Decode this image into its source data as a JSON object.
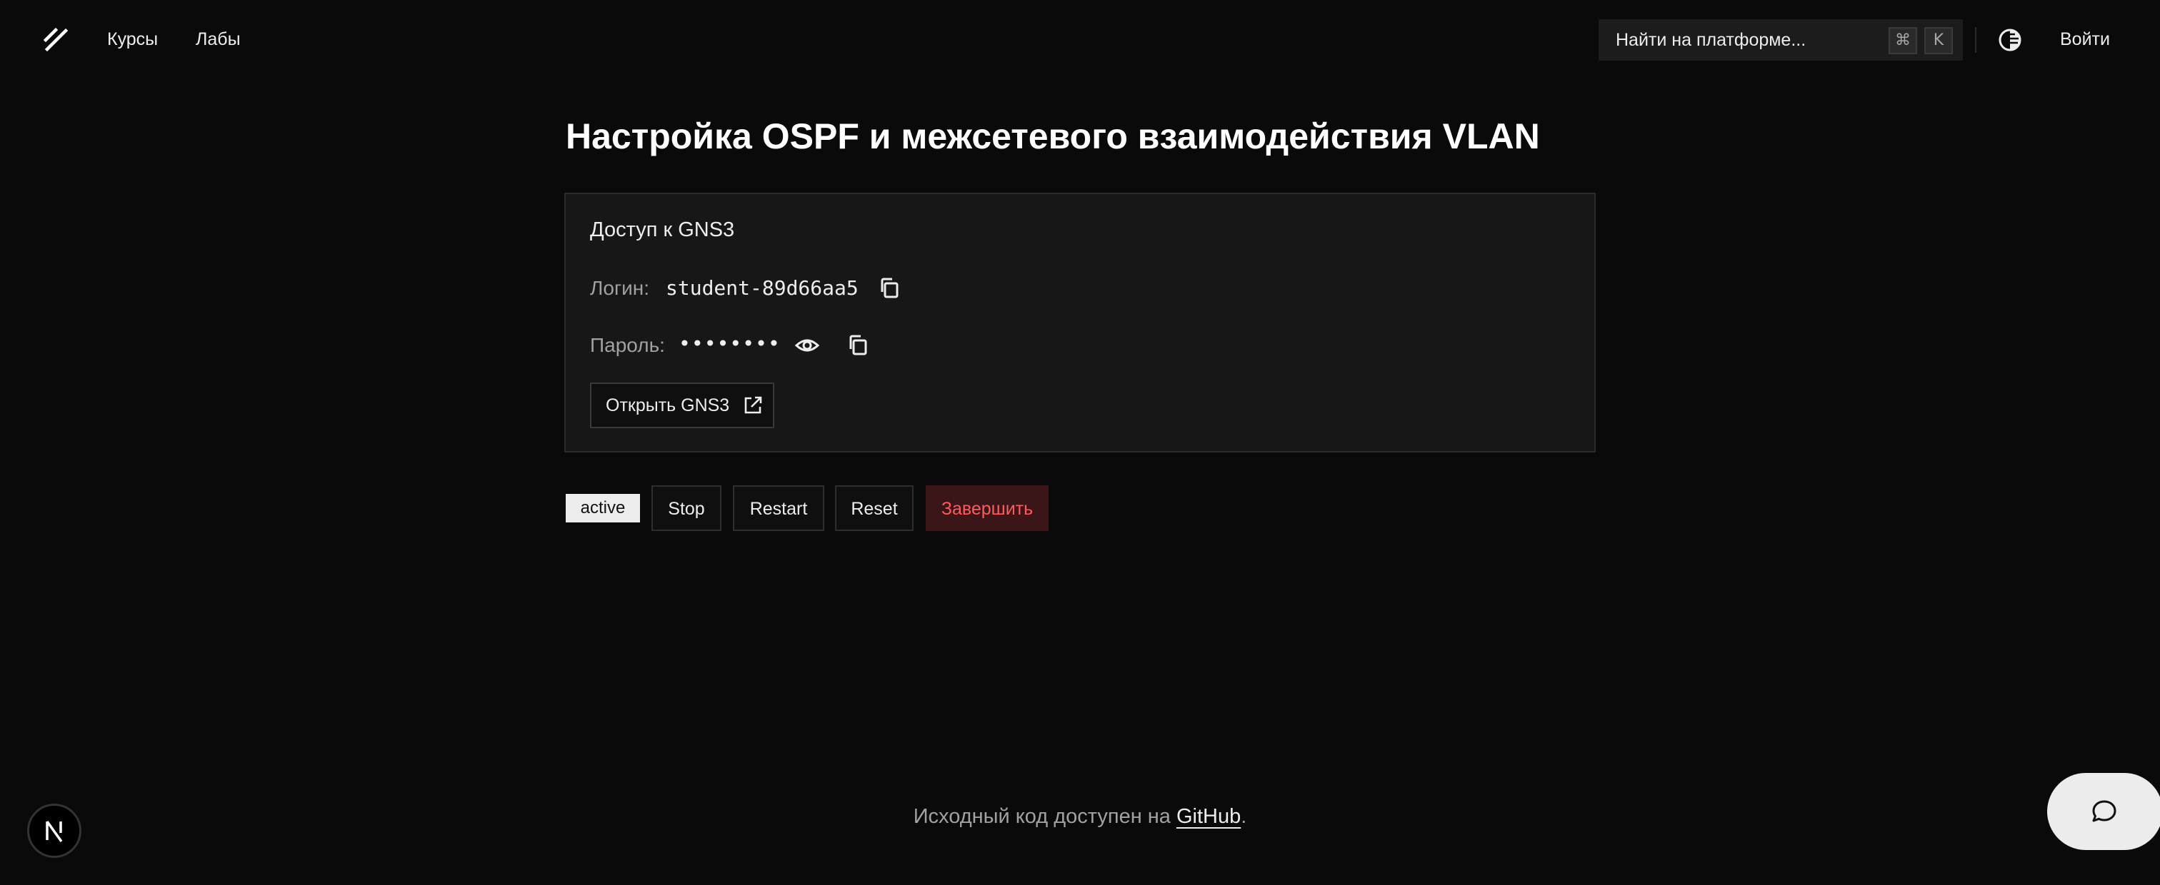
{
  "header": {
    "nav": [
      {
        "label": "Курсы"
      },
      {
        "label": "Лабы"
      }
    ],
    "search": {
      "placeholder": "Найти на платформе...",
      "shortcut_cmd": "⌘",
      "shortcut_key": "K"
    },
    "login_label": "Войти"
  },
  "main": {
    "title": "Настройка OSPF и межсетевого взаимодействия VLAN",
    "card": {
      "title": "Доступ к GNS3",
      "login_label": "Логин:",
      "login_value": "student-89d66aa5",
      "password_label": "Пароль:",
      "password_value": "••••••••",
      "open_button_label": "Открыть GNS3"
    },
    "status": "active",
    "actions": [
      {
        "label": "Stop"
      },
      {
        "label": "Restart"
      },
      {
        "label": "Reset"
      },
      {
        "label": "Завершить"
      }
    ]
  },
  "footer": {
    "text_prefix": "Исходный код доступен на ",
    "link_label": "GitHub",
    "text_suffix": "."
  },
  "icons": {
    "logo": "slash-logo-icon",
    "theme": "theme-toggle-icon",
    "copy": "copy-icon",
    "eye": "eye-icon",
    "external": "external-link-icon",
    "next": "nextjs-logo-icon",
    "chat": "chat-bubble-icon"
  },
  "colors": {
    "background": "#0a0a0a",
    "card": "#171717",
    "danger_text": "#ff5a5f",
    "danger_bg": "#3a1618",
    "badge_bg": "#ededed"
  }
}
